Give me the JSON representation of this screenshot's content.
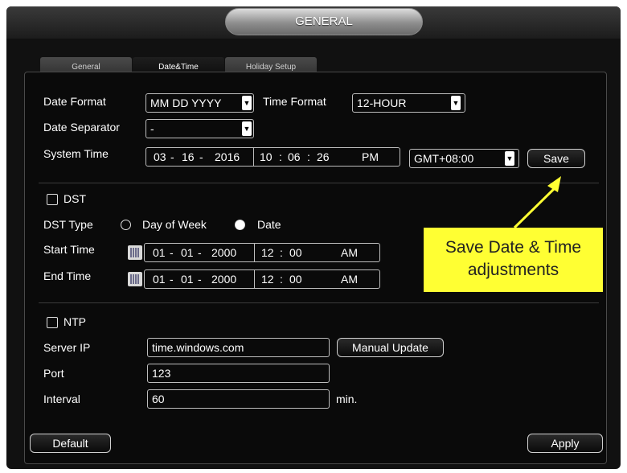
{
  "window": {
    "title": "GENERAL"
  },
  "tabs": [
    {
      "label": "General"
    },
    {
      "label": "Date&Time"
    },
    {
      "label": "Holiday Setup"
    }
  ],
  "date_format": {
    "label": "Date Format",
    "value": "MM DD YYYY"
  },
  "time_format": {
    "label": "Time Format",
    "value": "12-HOUR"
  },
  "date_separator": {
    "label": "Date Separator",
    "value": "-"
  },
  "system_time": {
    "label": "System Time",
    "month": "03",
    "day": "16",
    "year": "2016",
    "hour": "10",
    "minute": "06",
    "second": "26",
    "ampm": "PM",
    "timezone": "GMT+08:00",
    "save_label": "Save"
  },
  "dst": {
    "label": "DST",
    "checked": false,
    "type_label": "DST Type",
    "option_day_of_week": "Day of Week",
    "option_date": "Date",
    "selected": "Date",
    "start": {
      "label": "Start Time",
      "month": "01",
      "day": "01",
      "year": "2000",
      "hour": "12",
      "minute": "00",
      "ampm": "AM"
    },
    "end": {
      "label": "End Time",
      "month": "01",
      "day": "01",
      "year": "2000",
      "hour": "12",
      "minute": "00",
      "ampm": "AM"
    }
  },
  "ntp": {
    "label": "NTP",
    "checked": false,
    "server_label": "Server IP",
    "server_value": "time.windows.com",
    "manual_update_label": "Manual Update",
    "port_label": "Port",
    "port_value": "123",
    "interval_label": "Interval",
    "interval_value": "60",
    "interval_unit": "min."
  },
  "footer": {
    "default_label": "Default",
    "apply_label": "Apply"
  },
  "callout": {
    "line1": "Save Date & Time",
    "line2": "adjustments",
    "color": "#ffff33"
  },
  "icons": {
    "dropdown": "chevron-down-icon",
    "calendar": "calendar-icon"
  }
}
